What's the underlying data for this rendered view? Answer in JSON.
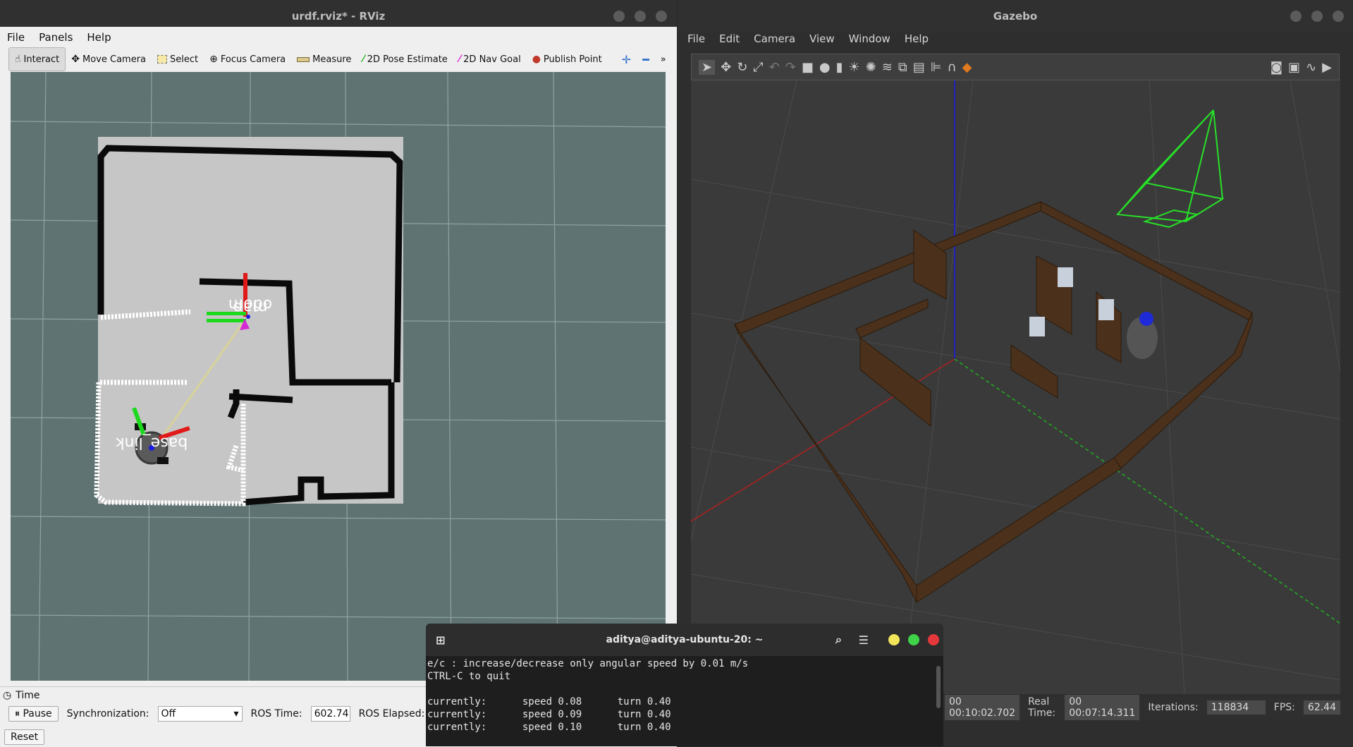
{
  "rviz": {
    "title": "urdf.rviz* - RViz",
    "menu": [
      "File",
      "Panels",
      "Help"
    ],
    "tools": [
      {
        "label": "Interact",
        "icon": "hand-icon"
      },
      {
        "label": "Move Camera",
        "icon": "move-icon"
      },
      {
        "label": "Select",
        "icon": "select-icon"
      },
      {
        "label": "Focus Camera",
        "icon": "focus-icon"
      },
      {
        "label": "Measure",
        "icon": "ruler-icon"
      },
      {
        "label": "2D Pose Estimate",
        "icon": "pose-arrow-icon"
      },
      {
        "label": "2D Nav Goal",
        "icon": "nav-arrow-icon"
      },
      {
        "label": "Publish Point",
        "icon": "pin-icon"
      }
    ],
    "frame_labels": {
      "odom": "odom",
      "map": "map",
      "base_link": "base_link"
    },
    "time_panel": {
      "title": "Time",
      "pause_label": "Pause",
      "sync_label": "Synchronization:",
      "sync_value": "Off",
      "ros_time_label": "ROS Time:",
      "ros_time_value": "602.74",
      "ros_elapsed_label": "ROS Elapsed:",
      "reset_label": "Reset"
    }
  },
  "gazebo": {
    "title": "Gazebo",
    "menu": [
      "File",
      "Edit",
      "Camera",
      "View",
      "Window",
      "Help"
    ],
    "status": {
      "sim_time_value": "00 00:10:02.702",
      "real_time_label": "Real Time:",
      "real_time_value": "00 00:07:14.311",
      "iterations_label": "Iterations:",
      "iterations_value": "118834",
      "fps_label": "FPS:",
      "fps_value": "62.44"
    }
  },
  "terminal": {
    "title": "aditya@aditya-ubuntu-20: ~",
    "lines": [
      "e/c : increase/decrease only angular speed by 0.01 m/s",
      "CTRL-C to quit",
      "",
      "currently:      speed 0.08      turn 0.40",
      "currently:      speed 0.09      turn 0.40",
      "currently:      speed 0.10      turn 0.40"
    ]
  }
}
